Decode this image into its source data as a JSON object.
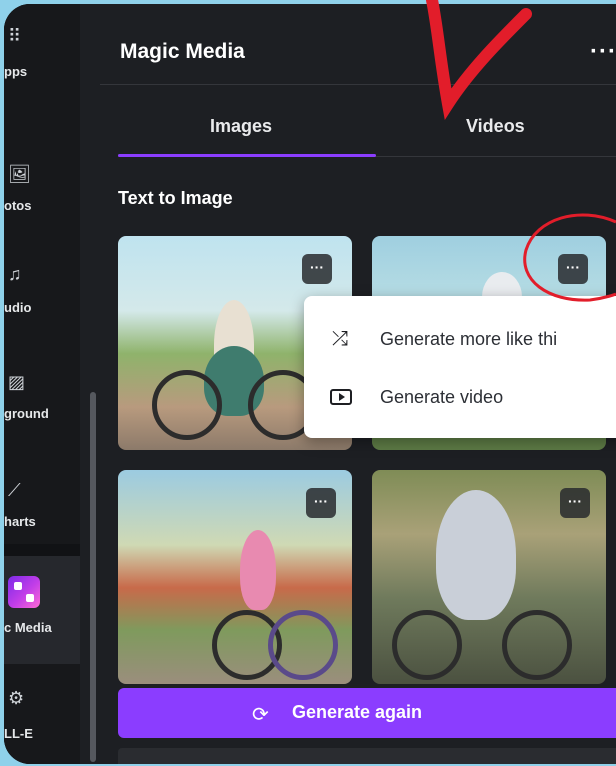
{
  "rail": {
    "items": [
      {
        "label": "pps",
        "icon": "apps-grid-icon"
      },
      {
        "label": "otos",
        "icon": "photos-icon"
      },
      {
        "label": "udio",
        "icon": "audio-icon"
      },
      {
        "label": "ground",
        "icon": "background-icon"
      },
      {
        "label": "harts",
        "icon": "charts-icon"
      },
      {
        "label": "c Media",
        "icon": "magic-media-icon"
      },
      {
        "label": "LL-E",
        "icon": "openai-icon"
      }
    ]
  },
  "panel": {
    "title": "Magic Media",
    "more_label": "···",
    "tabs": [
      {
        "label": "Images",
        "active": true
      },
      {
        "label": "Videos",
        "active": false
      }
    ],
    "section_title": "Text to Image",
    "thumb_menu_label": "···"
  },
  "context_menu": {
    "items": [
      {
        "label": "Generate more like thi",
        "icon": "shuffle-icon"
      },
      {
        "label": "Generate video",
        "icon": "play-video-icon"
      }
    ]
  },
  "generate_button": {
    "label": "Generate again",
    "icon": "refresh-icon"
  },
  "colors": {
    "accent": "#8b3dff",
    "panel_bg": "#1d1f23",
    "annotation_red": "#e21d2a",
    "page_bg": "#8fd1ea"
  }
}
